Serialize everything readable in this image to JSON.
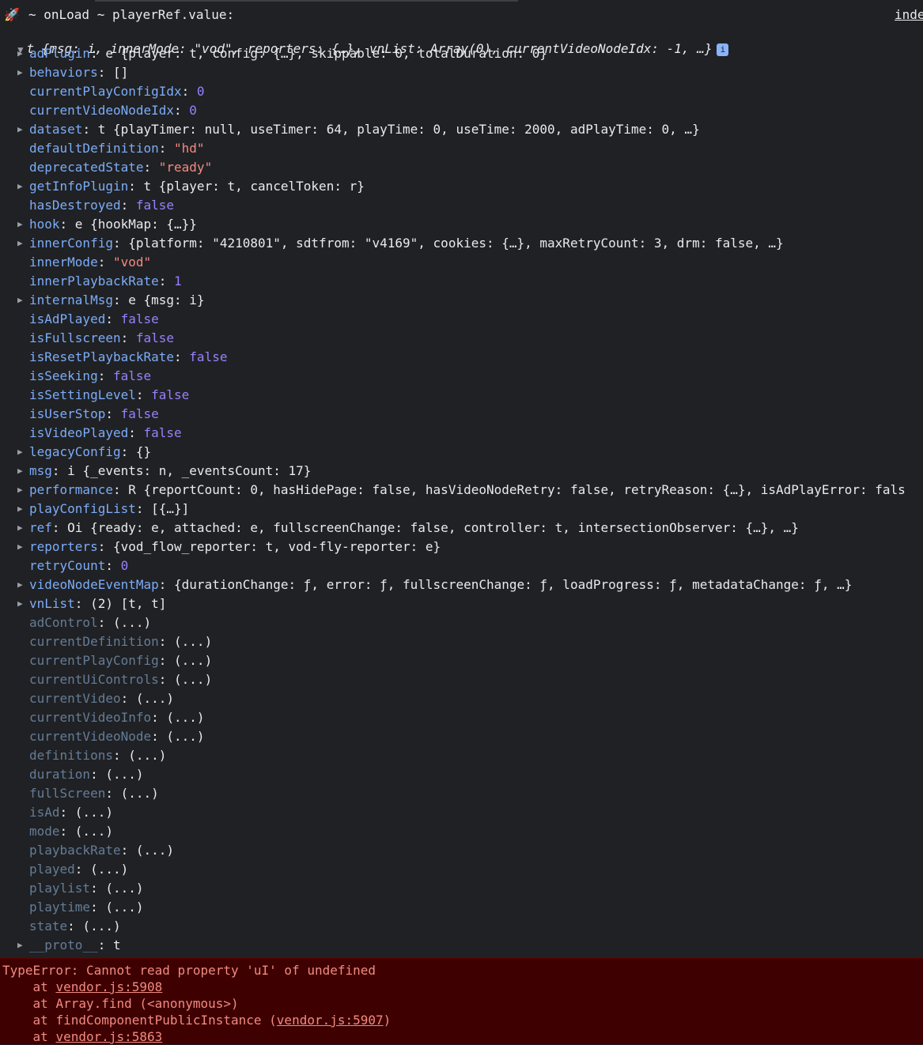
{
  "header": {
    "icon": "rocket-icon",
    "label": "~ onLoad ~ playerRef.value:",
    "source_link": "inde"
  },
  "summary": {
    "text": "t {msg: i, innerMode: \"vod\", reporters: {…}, vnList: Array(0), currentVideoNodeIdx: -1, …}",
    "badge": "i"
  },
  "props": [
    {
      "expand": true,
      "key": "adPlugin",
      "value": "e {player: t, config: {…}, skippable: 0, totalDuration: 0}"
    },
    {
      "expand": true,
      "key": "behaviors",
      "value": "[]"
    },
    {
      "expand": false,
      "key": "currentPlayConfigIdx",
      "value": "0",
      "type": "num"
    },
    {
      "expand": false,
      "key": "currentVideoNodeIdx",
      "value": "0",
      "type": "num"
    },
    {
      "expand": true,
      "key": "dataset",
      "value": "t {playTimer: null, useTimer: 64, playTime: 0, useTime: 2000, adPlayTime: 0, …}"
    },
    {
      "expand": false,
      "key": "defaultDefinition",
      "value": "\"hd\"",
      "type": "str"
    },
    {
      "expand": false,
      "key": "deprecatedState",
      "value": "\"ready\"",
      "type": "str"
    },
    {
      "expand": true,
      "key": "getInfoPlugin",
      "value": "t {player: t, cancelToken: r}"
    },
    {
      "expand": false,
      "key": "hasDestroyed",
      "value": "false",
      "type": "bool"
    },
    {
      "expand": true,
      "key": "hook",
      "value": "e {hookMap: {…}}"
    },
    {
      "expand": true,
      "key": "innerConfig",
      "value": "{platform: \"4210801\", sdtfrom: \"v4169\", cookies: {…}, maxRetryCount: 3, drm: false, …}"
    },
    {
      "expand": false,
      "key": "innerMode",
      "value": "\"vod\"",
      "type": "str"
    },
    {
      "expand": false,
      "key": "innerPlaybackRate",
      "value": "1",
      "type": "num"
    },
    {
      "expand": true,
      "key": "internalMsg",
      "value": "e {msg: i}"
    },
    {
      "expand": false,
      "key": "isAdPlayed",
      "value": "false",
      "type": "bool"
    },
    {
      "expand": false,
      "key": "isFullscreen",
      "value": "false",
      "type": "bool"
    },
    {
      "expand": false,
      "key": "isResetPlaybackRate",
      "value": "false",
      "type": "bool"
    },
    {
      "expand": false,
      "key": "isSeeking",
      "value": "false",
      "type": "bool"
    },
    {
      "expand": false,
      "key": "isSettingLevel",
      "value": "false",
      "type": "bool"
    },
    {
      "expand": false,
      "key": "isUserStop",
      "value": "false",
      "type": "bool"
    },
    {
      "expand": false,
      "key": "isVideoPlayed",
      "value": "false",
      "type": "bool"
    },
    {
      "expand": true,
      "key": "legacyConfig",
      "value": "{}"
    },
    {
      "expand": true,
      "key": "msg",
      "value": "i {_events: n, _eventsCount: 17}"
    },
    {
      "expand": true,
      "key": "performance",
      "value": "R {reportCount: 0, hasHidePage: false, hasVideoNodeRetry: false, retryReason: {…}, isAdPlayError: fals"
    },
    {
      "expand": true,
      "key": "playConfigList",
      "value": "[{…}]"
    },
    {
      "expand": true,
      "key": "ref",
      "value": "Oi {ready: e, attached: e, fullscreenChange: false, controller: t, intersectionObserver: {…}, …}"
    },
    {
      "expand": true,
      "key": "reporters",
      "value": "{vod_flow_reporter: t, vod-fly-reporter: e}"
    },
    {
      "expand": false,
      "key": "retryCount",
      "value": "0",
      "type": "num"
    },
    {
      "expand": true,
      "key": "videoNodeEventMap",
      "value": "{durationChange: ƒ, error: ƒ, fullscreenChange: ƒ, loadProgress: ƒ, metadataChange: ƒ, …}"
    },
    {
      "expand": true,
      "key": "vnList",
      "value": "(2) [t, t]"
    },
    {
      "expand": false,
      "key": "adControl",
      "value": "(...)",
      "getter": true
    },
    {
      "expand": false,
      "key": "currentDefinition",
      "value": "(...)",
      "getter": true
    },
    {
      "expand": false,
      "key": "currentPlayConfig",
      "value": "(...)",
      "getter": true
    },
    {
      "expand": false,
      "key": "currentUiControls",
      "value": "(...)",
      "getter": true
    },
    {
      "expand": false,
      "key": "currentVideo",
      "value": "(...)",
      "getter": true
    },
    {
      "expand": false,
      "key": "currentVideoInfo",
      "value": "(...)",
      "getter": true
    },
    {
      "expand": false,
      "key": "currentVideoNode",
      "value": "(...)",
      "getter": true
    },
    {
      "expand": false,
      "key": "definitions",
      "value": "(...)",
      "getter": true
    },
    {
      "expand": false,
      "key": "duration",
      "value": "(...)",
      "getter": true
    },
    {
      "expand": false,
      "key": "fullScreen",
      "value": "(...)",
      "getter": true
    },
    {
      "expand": false,
      "key": "isAd",
      "value": "(...)",
      "getter": true
    },
    {
      "expand": false,
      "key": "mode",
      "value": "(...)",
      "getter": true
    },
    {
      "expand": false,
      "key": "playbackRate",
      "value": "(...)",
      "getter": true
    },
    {
      "expand": false,
      "key": "played",
      "value": "(...)",
      "getter": true
    },
    {
      "expand": false,
      "key": "playlist",
      "value": "(...)",
      "getter": true
    },
    {
      "expand": false,
      "key": "playtime",
      "value": "(...)",
      "getter": true
    },
    {
      "expand": false,
      "key": "state",
      "value": "(...)",
      "getter": true
    },
    {
      "expand": true,
      "key": "__proto__",
      "value": "t",
      "getter": true
    }
  ],
  "error": {
    "message": "TypeError: Cannot read property 'uI' of undefined",
    "stack": [
      {
        "prefix": "    at ",
        "text": "",
        "link": "vendor.js:5908",
        "suffix": ""
      },
      {
        "prefix": "    at ",
        "text": "Array.find (<anonymous>)",
        "link": "",
        "suffix": ""
      },
      {
        "prefix": "    at ",
        "text": "findComponentPublicInstance (",
        "link": "vendor.js:5907",
        "suffix": ")"
      },
      {
        "prefix": "    at ",
        "text": "",
        "link": "vendor.js:5863",
        "suffix": ""
      }
    ]
  },
  "colors": {
    "background": "#202124",
    "key": "#7cacf8",
    "string": "#f28b82",
    "number": "#9980ff",
    "error_bg": "#3e0000"
  }
}
